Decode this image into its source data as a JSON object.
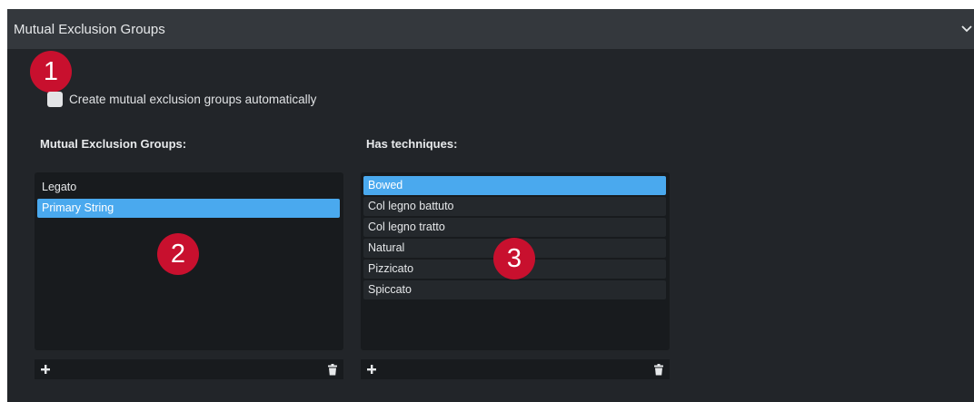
{
  "panel": {
    "title": "Mutual Exclusion Groups",
    "collapse_icon": "chevron-down-icon"
  },
  "callouts": [
    "1",
    "2",
    "3"
  ],
  "auto_create": {
    "label": "Create mutual exclusion groups automatically",
    "checked": false
  },
  "groups": {
    "heading": "Mutual Exclusion Groups:",
    "items": [
      "Legato",
      "Primary String"
    ],
    "selected_index": 1,
    "add_icon": "plus-icon",
    "delete_icon": "trash-icon"
  },
  "techniques": {
    "heading": "Has techniques:",
    "items": [
      "Bowed",
      "Col legno battuto",
      "Col legno tratto",
      "Natural",
      "Pizzicato",
      "Spiccato"
    ],
    "selected_index": 0,
    "add_icon": "plus-icon",
    "delete_icon": "trash-icon"
  },
  "colors": {
    "panel_bg": "#222529",
    "header_bg": "#34383d",
    "list_bg": "#181b1e",
    "selection": "#4aa9ee",
    "callout": "#c8102e"
  }
}
